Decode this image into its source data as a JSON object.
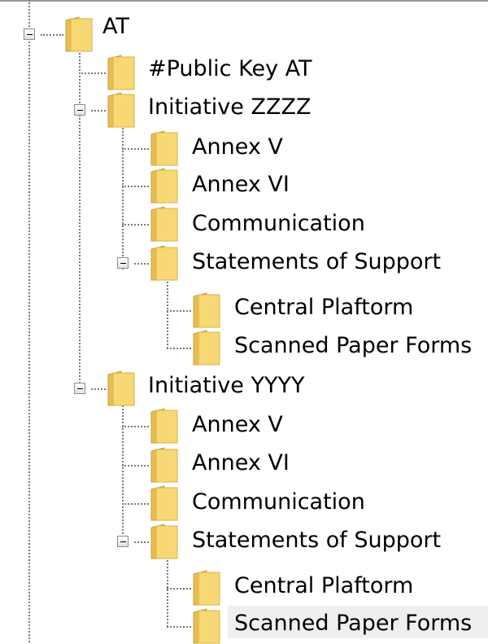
{
  "tree": {
    "root": {
      "label": "AT",
      "public_key": "#Public Key AT",
      "initiatives": [
        {
          "label": "Initiative  ZZZZ",
          "children": [
            {
              "label": "Annex V"
            },
            {
              "label": "Annex VI"
            },
            {
              "label": "Communication"
            },
            {
              "label": "Statements of Support",
              "children": [
                {
                  "label": "Central Plaftorm"
                },
                {
                  "label": "Scanned Paper Forms"
                }
              ]
            }
          ]
        },
        {
          "label": "Initiative YYYY",
          "children": [
            {
              "label": "Annex V"
            },
            {
              "label": "Annex VI"
            },
            {
              "label": "Communication"
            },
            {
              "label": "Statements of Support",
              "children": [
                {
                  "label": "Central Plaftorm"
                },
                {
                  "label": "Scanned Paper Forms"
                }
              ]
            }
          ]
        }
      ]
    },
    "selected_item": "Scanned Paper Forms"
  },
  "colors": {
    "folder_fill": "#f8d775",
    "folder_edge": "#d7b348",
    "connector": "#7a7a7a",
    "selection": "#efefef"
  },
  "icons": {
    "expander": "minus-expander-icon",
    "node": "folder-icon"
  }
}
